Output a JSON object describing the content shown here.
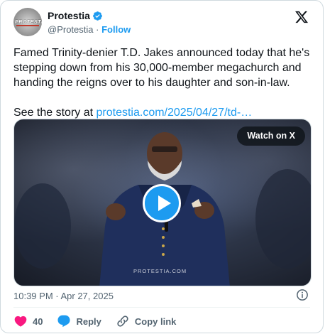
{
  "account": {
    "name": "Protestia",
    "handle": "@Protestia",
    "separator": "·",
    "follow_label": "Follow",
    "avatar_text": "PROTESTIA",
    "verified": true
  },
  "tweet": {
    "paragraph1": "Famed Trinity-denier T.D. Jakes announced today that he's stepping down from his 30,000-member megachurch and handing the reigns over to his daughter and son-in-law.",
    "see_story_prefix": "See the story at ",
    "link_text": "protestia.com/2025/04/27/td-…"
  },
  "media": {
    "watch_label": "Watch on X",
    "watermark": "PROTESTIA.COM",
    "play_icon": "play-icon"
  },
  "timestamp": "10:39 PM · Apr 27, 2025",
  "actions": {
    "like_count": "40",
    "reply_label": "Reply",
    "copy_label": "Copy link"
  },
  "colors": {
    "accent": "#1d9bf0",
    "like": "#f91880",
    "muted": "#536471"
  },
  "icons": [
    "verified-badge-icon",
    "x-logo-icon",
    "info-icon",
    "heart-icon",
    "reply-icon",
    "link-icon",
    "play-icon"
  ]
}
